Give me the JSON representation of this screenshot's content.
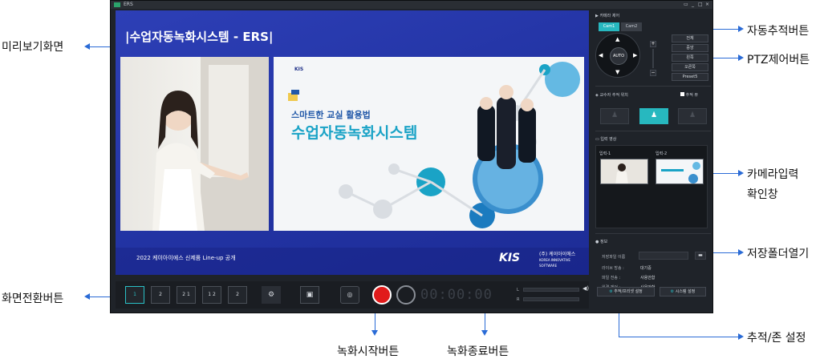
{
  "annotations": {
    "preview": "미리보기화면",
    "switch_button": "화면전환버튼",
    "auto_track": "자동추적버튼",
    "ptz": "PTZ제어버튼",
    "camera_input_1": "카메라입력",
    "camera_input_2": "확인창",
    "save_folder": "저장폴더열기",
    "track_zone": "추적/존 설정",
    "rec_start": "녹화시작버튼",
    "rec_end": "녹화종료버튼"
  },
  "window": {
    "title": "ERS",
    "controls": [
      "▭",
      "_",
      "□",
      "×"
    ]
  },
  "preview": {
    "title": "|수업자동녹화시스템 -  ERS|",
    "slide": {
      "logo": "KIS",
      "subtitle": "스마트한 교실 활용법",
      "main": "수업자동녹화시스템"
    },
    "footer_text": "2022 케이아이에스 신제품  Line-up 공개",
    "brand": "KIS",
    "brand_kr": "(주) 케이아이에스",
    "brand_en": "KOREA INNOVATIVE SOFTWARE"
  },
  "toolbar": {
    "layouts": [
      "1",
      "2",
      "2 1",
      "1 2",
      "2"
    ],
    "timer": "00:00:00",
    "level_left": "L",
    "level_right": "R"
  },
  "panel": {
    "camera_control": "카메라 제어",
    "tabs": [
      "Cam1",
      "Cam2"
    ],
    "auto": "AUTO",
    "presets": [
      "전체",
      "중앙",
      "왼쪽",
      "오른쪽",
      "Preset5"
    ],
    "zoom_plus": "+",
    "zoom_minus": "−",
    "tracking_position": "교수자 추적 위치",
    "tracking_view": "추적 뷰",
    "input_video": "입력 영상",
    "input1": "입력-1",
    "input2": "입력-2",
    "info": "정보",
    "save_file_name": "저장파일 이름",
    "live": "라이브 방송 :",
    "live_val": "대기중",
    "file_transfer": "파일 전송 :",
    "file_transfer_val": "사용안함",
    "remote": "원격 제어 :",
    "remote_val": "사용안함",
    "track_preset_btn": "추적/프리셋 설정",
    "system_btn": "시스템 설정"
  }
}
